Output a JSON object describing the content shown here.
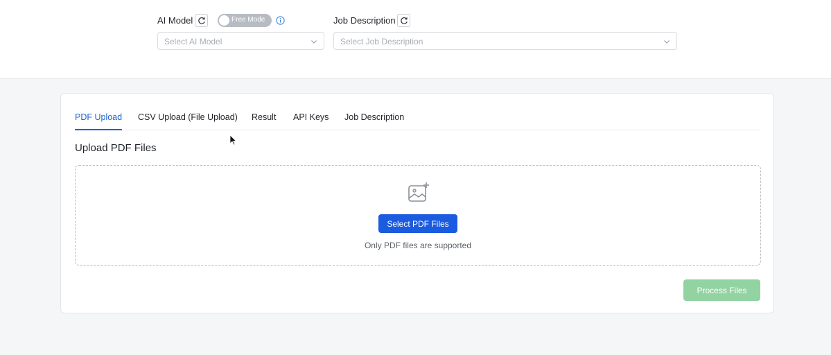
{
  "header": {
    "ai_model": {
      "label": "AI Model",
      "refresh_icon": "refresh-icon",
      "mode_toggle_label": "Free Mode",
      "info_icon": "info-icon",
      "select_placeholder": "Select AI Model"
    },
    "job_description": {
      "label": "Job Description",
      "refresh_icon": "refresh-icon",
      "select_placeholder": "Select Job Description"
    }
  },
  "tabs": [
    {
      "label": "PDF Upload",
      "active": true
    },
    {
      "label": "CSV Upload (File Upload)",
      "active": false
    },
    {
      "label": "Result",
      "active": false
    },
    {
      "label": "API Keys",
      "active": false
    },
    {
      "label": "Job Description",
      "active": false
    }
  ],
  "upload": {
    "title": "Upload PDF Files",
    "icon": "add-image-icon",
    "select_button": "Select PDF Files",
    "hint": "Only PDF files are supported"
  },
  "actions": {
    "process_button": "Process Files"
  },
  "colors": {
    "accent": "#1b64d9",
    "primary_button": "#1b5bdf",
    "process_button_disabled": "#93d3a2"
  }
}
